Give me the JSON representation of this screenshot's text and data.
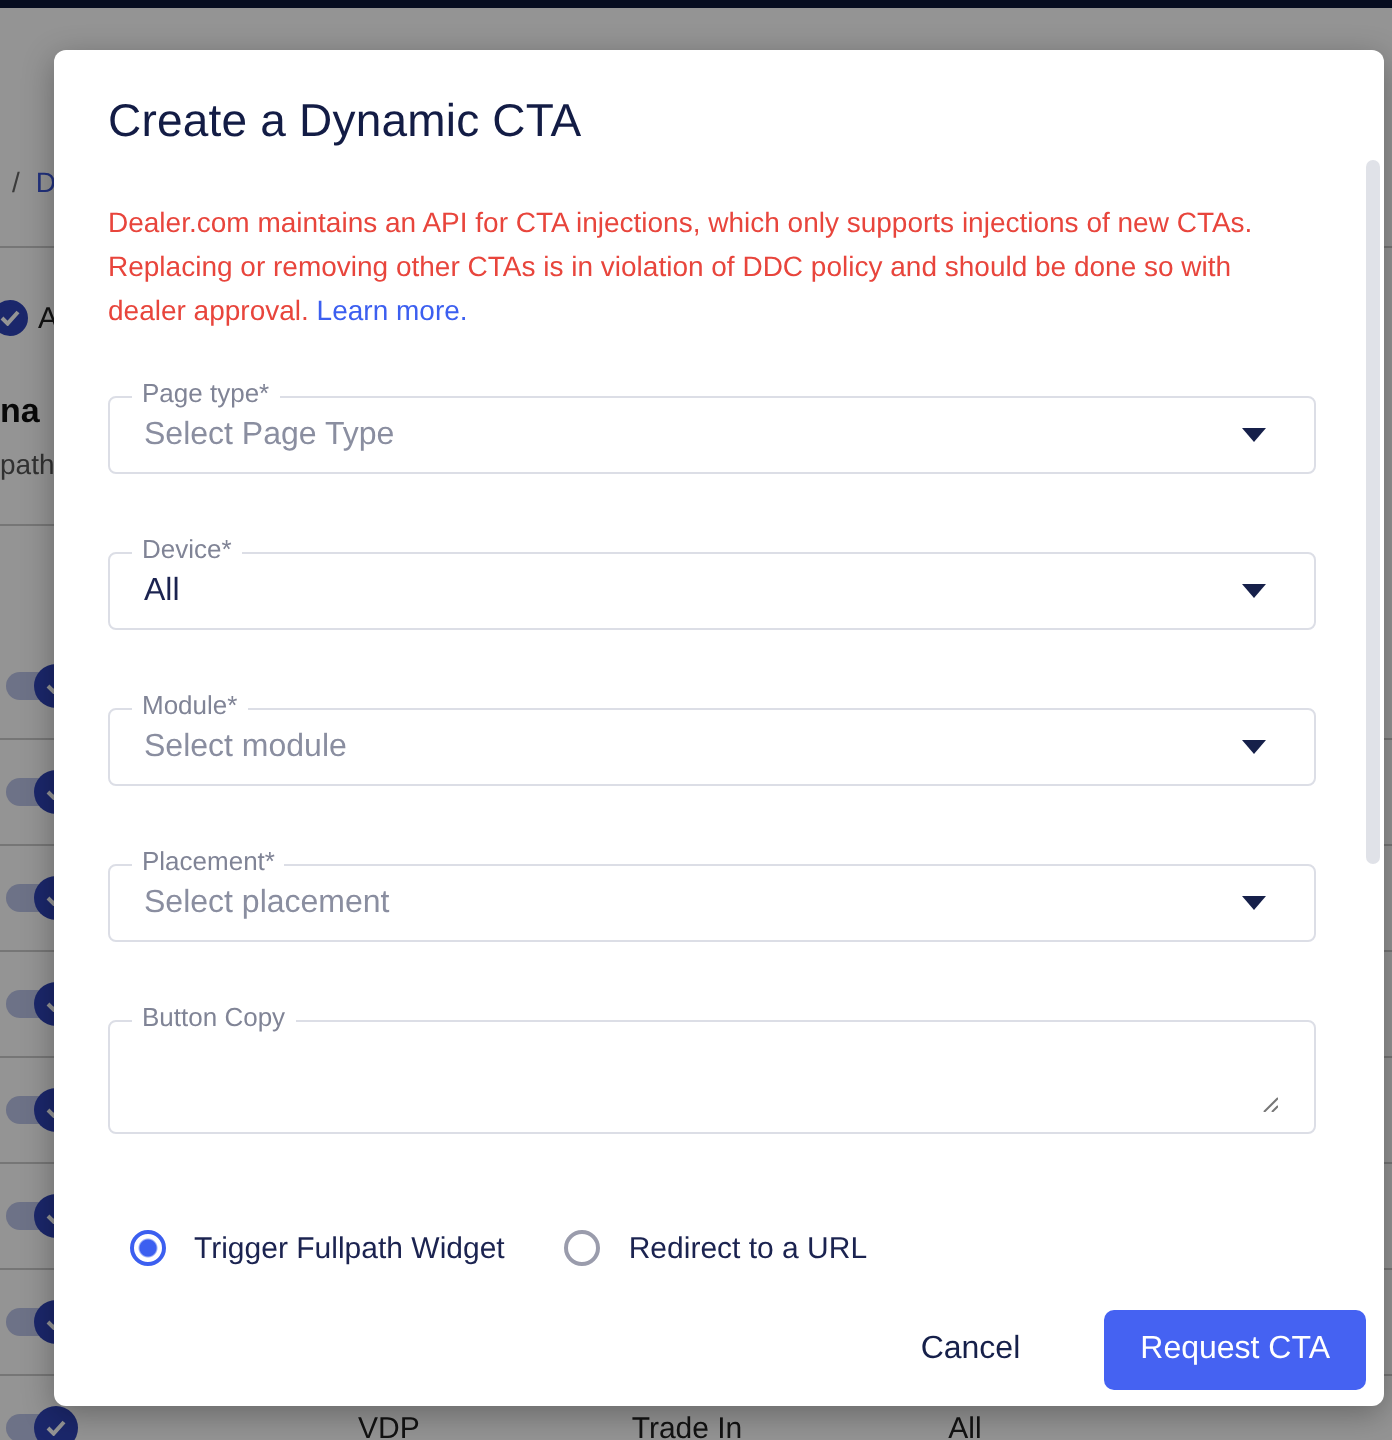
{
  "page": {
    "breadcrumb": [
      "/",
      "D"
    ],
    "select_all": {
      "label": "A",
      "checked": true
    },
    "heading": "na",
    "subheading": "path",
    "rows": [
      {
        "on": true
      },
      {
        "on": true
      },
      {
        "on": true
      },
      {
        "on": true
      },
      {
        "on": true
      },
      {
        "on": true
      },
      {
        "on": true
      }
    ],
    "last_row": {
      "on": true,
      "cells": [
        "VDP",
        "Trade In",
        "All"
      ]
    }
  },
  "dialog": {
    "title": "Create a Dynamic CTA",
    "notice": "Dealer.com maintains an API for CTA injections, which only supports injections of new CTAs. Replacing or removing other CTAs is in violation of DDC policy and should be done so with dealer approval.",
    "notice_link": "Learn more.",
    "fields": [
      {
        "kind": "select",
        "label": "Page type*",
        "placeholder": "Select Page Type"
      },
      {
        "kind": "select",
        "label": "Device*",
        "value": "All"
      },
      {
        "kind": "select",
        "label": "Module*",
        "placeholder": "Select module"
      },
      {
        "kind": "select",
        "label": "Placement*",
        "placeholder": "Select placement"
      },
      {
        "kind": "textarea",
        "label": "Button Copy"
      }
    ],
    "options": [
      {
        "label": "Trigger Fullpath Widget",
        "selected": true
      },
      {
        "label": "Redirect to a URL",
        "selected": false
      }
    ],
    "buttons": [
      {
        "kind": "text",
        "label": "Cancel"
      },
      {
        "kind": "primary",
        "label": "Request CTA"
      }
    ]
  }
}
